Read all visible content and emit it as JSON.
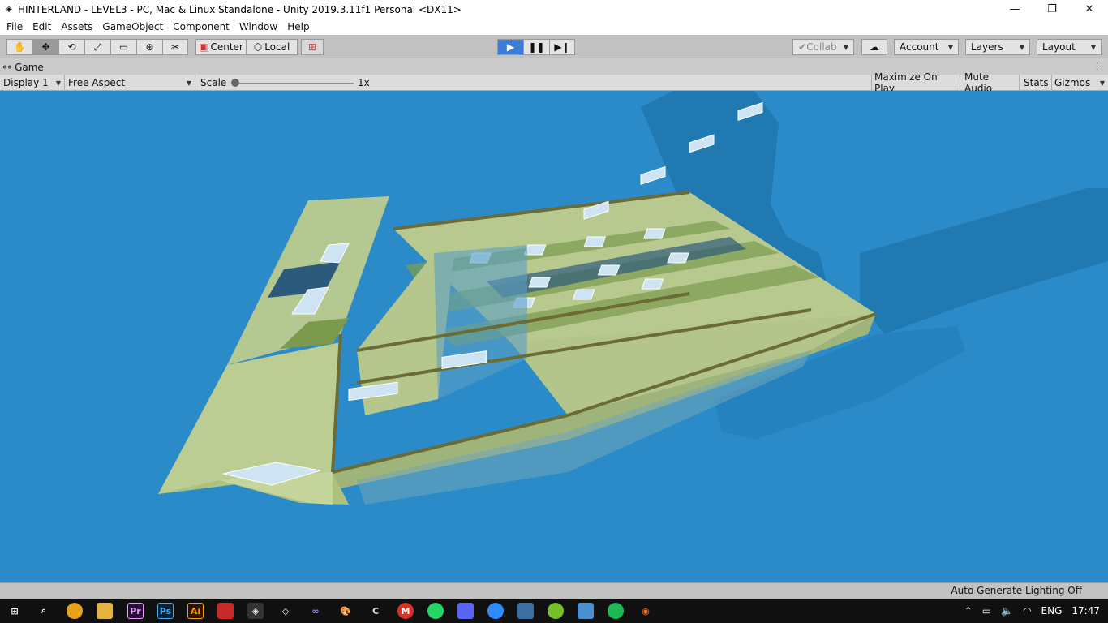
{
  "window": {
    "title": "HINTERLAND - LEVEL3 - PC, Mac & Linux Standalone - Unity 2019.3.11f1 Personal <DX11>",
    "minimize": "—",
    "maximize": "❐",
    "close": "✕"
  },
  "menu": [
    "File",
    "Edit",
    "Assets",
    "GameObject",
    "Component",
    "Window",
    "Help"
  ],
  "toolbar": {
    "tools": [
      "hand-tool",
      "move-tool",
      "rotate-tool",
      "scale-tool",
      "rect-tool",
      "transform-tool",
      "custom-tool"
    ],
    "pivot_label": "Center",
    "space_label": "Local",
    "collab_label": "Collab",
    "account_label": "Account",
    "layers_label": "Layers",
    "layout_label": "Layout"
  },
  "tab": {
    "label": "Game"
  },
  "gameview": {
    "display": "Display 1",
    "aspect": "Free Aspect",
    "scale_label": "Scale",
    "scale_value": "1x",
    "scale_level": 0.0,
    "maximize_on_play": "Maximize On Play",
    "mute_audio": "Mute Audio",
    "stats": "Stats",
    "gizmos": "Gizmos"
  },
  "status": {
    "message": "Auto Generate Lighting Off"
  },
  "colors": {
    "sky": "#2a8bc8",
    "wall": "#b9c98f",
    "wall_dark": "#8fa86a",
    "window": "#cfe4f2",
    "frame": "#6b6b36",
    "play_button": "#3e7bd6"
  },
  "taskbar": {
    "icons": [
      "windows-start-icon",
      "search-icon",
      "chrome-icon",
      "file-explorer-icon",
      "premiere-icon",
      "photoshop-icon",
      "illustrator-icon",
      "red-app-icon",
      "unity-icon",
      "unity-hub-icon",
      "visual-studio-icon",
      "paint-icon",
      "ccleaner-icon",
      "gmail-icon",
      "whatsapp-icon",
      "discord-icon",
      "zoom-icon",
      "news-icon",
      "utorrent-icon",
      "photos-icon",
      "spotify-icon",
      "blender-icon"
    ],
    "labels": {
      "premiere": "Pr",
      "photoshop": "Ps",
      "illustrator": "Ai"
    },
    "language": "ENG",
    "time": "17:47"
  }
}
